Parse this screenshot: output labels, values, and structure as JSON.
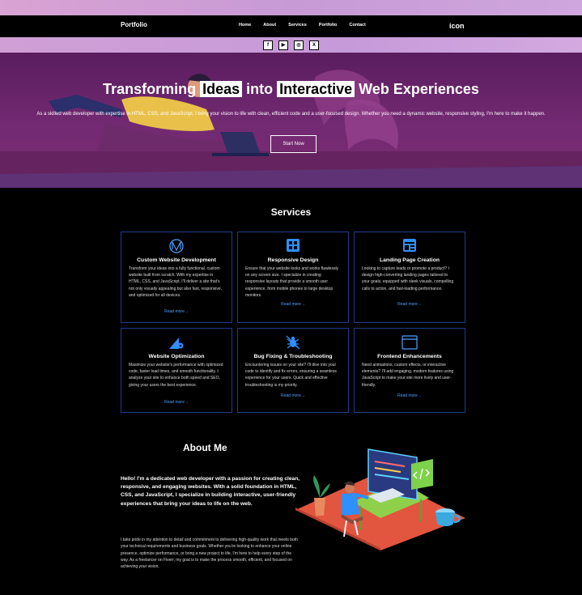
{
  "nav": {
    "brand": "Portfolio",
    "links": [
      "Home",
      "About",
      "Services",
      "Portfolio",
      "Contact"
    ],
    "icon_text": "icon"
  },
  "social": {
    "icons": [
      "facebook-icon",
      "youtube-icon",
      "instagram-icon",
      "x-icon"
    ],
    "glyphs": [
      "f",
      "▶",
      "◎",
      "X"
    ]
  },
  "hero": {
    "title_pre": "Transforming ",
    "title_hl1": "Ideas",
    "title_mid": " into ",
    "title_hl2": "Interactive",
    "title_post": " Web Experiences",
    "description": "As a skilled web developer with expertise in HTML, CSS, and JavaScript, I bring your vision to life with clean, efficient code and a user-focused design. Whether you need a dynamic website, responsive styling, I'm here to make it happen.",
    "cta": "Start Now"
  },
  "services": {
    "title": "Services",
    "read_more": "Read more",
    "cards": [
      {
        "title": "Custom Website Development",
        "icon": "monogram-icon",
        "text": "Transform your ideas into a fully functional, custom website built from scratch. With my expertise in HTML, CSS, and JavaScript, I'll deliver a site that's not only visually appealing but also fast, responsive, and optimized for all devices."
      },
      {
        "title": "Responsive Design",
        "icon": "grid-icon",
        "text": "Ensure that your website looks and works flawlessly on any screen size. I specialize in creating responsive layouts that provide a smooth user experience, from mobile phones to large desktop monitors."
      },
      {
        "title": "Landing Page Creation",
        "icon": "landing-page-icon",
        "text": "Looking to capture leads or promote a product? I design high-converting landing pages tailored to your goals, equipped with sleek visuals, compelling calls to action, and fast-loading performance."
      },
      {
        "title": "Website Optimization",
        "icon": "optimization-gear-icon",
        "text": "Maximize your website's performance with optimized code, faster load times, and smooth functionality. I analyze your site to enhance both speed and SEO, giving your users the best experience."
      },
      {
        "title": "Bug Fixing & Troubleshooting",
        "icon": "bug-icon",
        "text": "Encountering issues on your site? I'll dive into your code to identify and fix errors, ensuring a seamless experience for your users. Quick and effective troubleshooting is my priority."
      },
      {
        "title": "Frontend Enhancements",
        "icon": "browser-window-icon",
        "text": "Need animations, custom effects, or interactive elements? I'll add engaging, modern features using JavaScript to make your site more lively and user-friendly."
      }
    ]
  },
  "about": {
    "title": "About Me",
    "lead": "Hello! I'm a dedicated web developer with a passion for creating clean, responsive, and engaging websites. With a solid foundation in HTML, CSS, and JavaScript, I specialize in building interactive, user-friendly experiences that bring your ideas to life on the web.",
    "body": "I take pride in my attention to detail and commitment to delivering high-quality work that meets both your technical requirements and business goals. Whether you're looking to enhance your online presence, optimize performance, or bring a new project to life, I'm here to help every step of the way. As a freelancer on Fiverr, my goal is to make the process smooth, efficient, and focused on achieving your vision."
  },
  "colors": {
    "accent_link": "#4aa3ff",
    "card_border": "#1f3d8f",
    "hero_purple": "#732a72"
  }
}
